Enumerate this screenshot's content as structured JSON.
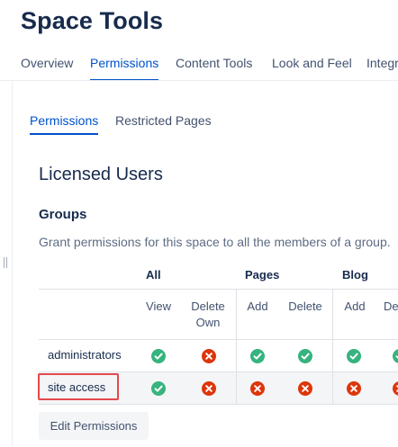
{
  "page": {
    "title": "Space Tools"
  },
  "top_tabs": [
    {
      "label": "Overview"
    },
    {
      "label": "Permissions",
      "active": true
    },
    {
      "label": "Content Tools"
    },
    {
      "label": "Look and Feel"
    },
    {
      "label": "Integr"
    }
  ],
  "sub_tabs": [
    {
      "label": "Permissions",
      "active": true
    },
    {
      "label": "Restricted Pages"
    }
  ],
  "section": {
    "title": "Licensed Users",
    "groups_title": "Groups",
    "description": "Grant permissions for this space to all the members of a group."
  },
  "table": {
    "categories": [
      "All",
      "Pages",
      "Blog"
    ],
    "subheaders": {
      "view": "View",
      "delete_own_1": "Delete",
      "delete_own_2": "Own",
      "pages_add": "Add",
      "pages_delete": "Delete",
      "blog_add": "Add",
      "blog_delete_partial": "De"
    },
    "rows": [
      {
        "group": "administrators",
        "perms": [
          "granted",
          "denied",
          "granted",
          "granted",
          "granted",
          "granted"
        ]
      },
      {
        "group": "site access",
        "perms": [
          "granted",
          "denied",
          "denied",
          "denied",
          "denied",
          "denied"
        ]
      }
    ]
  },
  "colors": {
    "accent": "#0052cc",
    "granted": "#36b37e",
    "denied": "#de350b",
    "highlight": "#e5484d"
  },
  "icons": {
    "granted": "check-circle-icon",
    "denied": "cross-circle-icon"
  },
  "actions": {
    "edit_permissions": "Edit Permissions"
  }
}
